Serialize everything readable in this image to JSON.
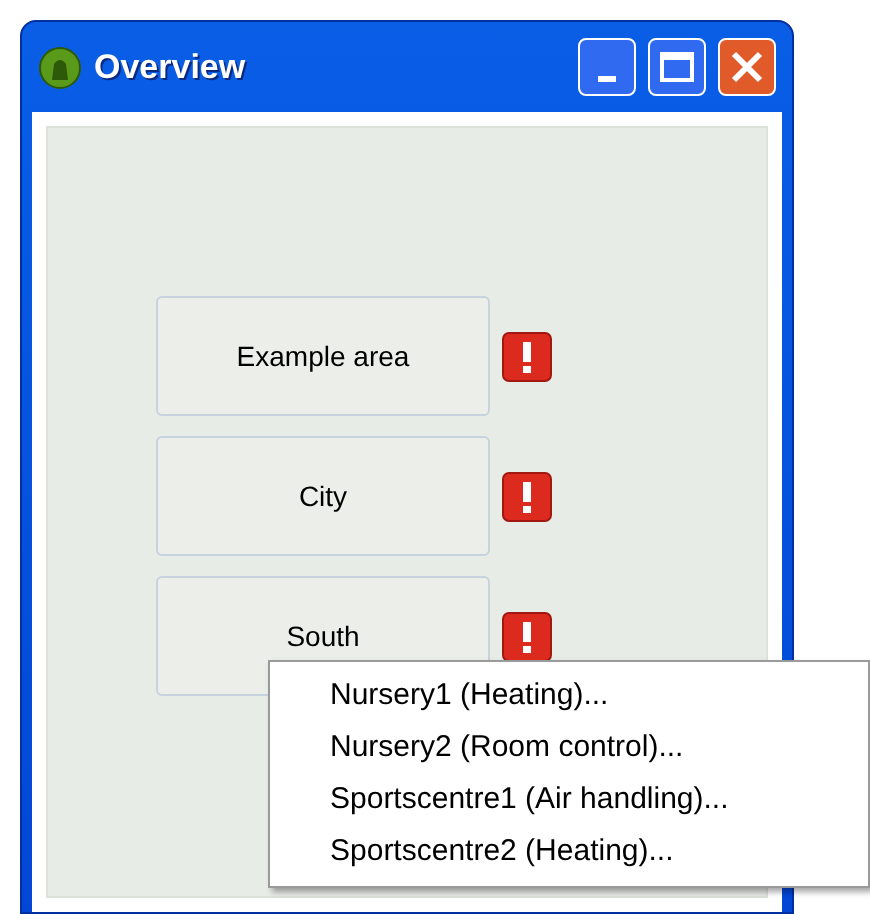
{
  "window": {
    "title": "Overview"
  },
  "areas": [
    {
      "label": "Example area",
      "alarm": true
    },
    {
      "label": "City",
      "alarm": true
    },
    {
      "label": "South",
      "alarm": true
    }
  ],
  "context_menu": {
    "items": [
      {
        "label": "Nursery1 (Heating)..."
      },
      {
        "label": "Nursery2 (Room control)..."
      },
      {
        "label": "Sportscentre1 (Air handling)..."
      },
      {
        "label": "Sportscentre2 (Heating)..."
      }
    ]
  }
}
